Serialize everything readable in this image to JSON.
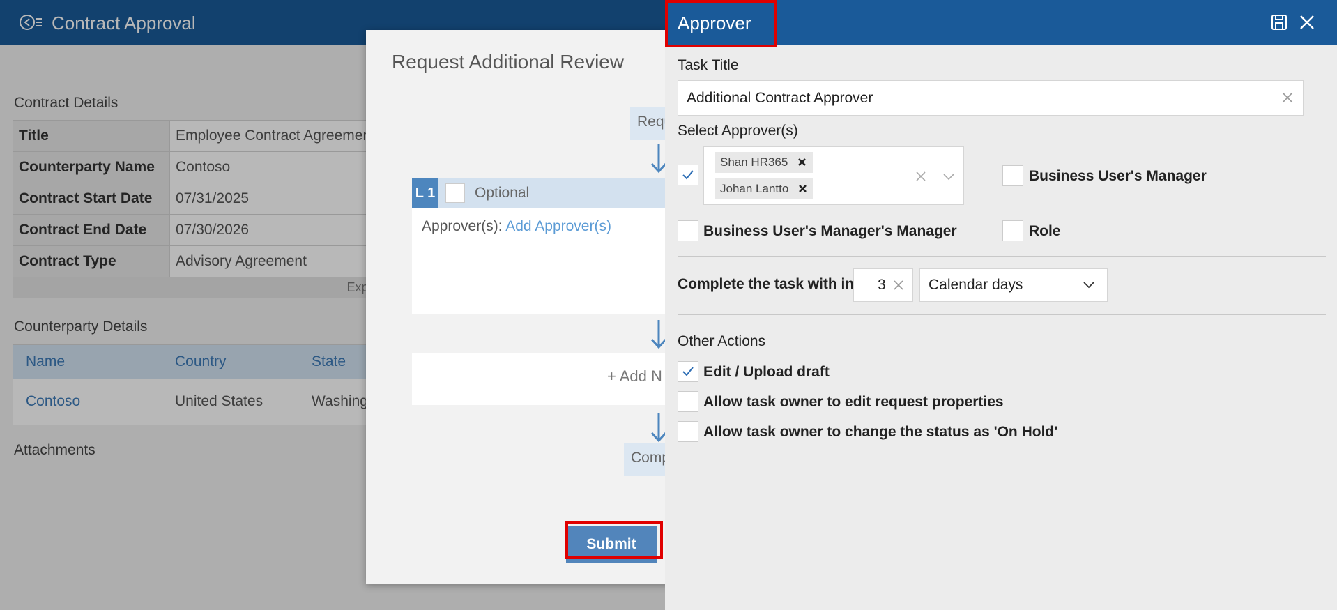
{
  "app": {
    "title": "Contract Approval"
  },
  "contract_details": {
    "section_title": "Contract Details",
    "rows": [
      {
        "label": "Title",
        "value": "Employee Contract Agreement"
      },
      {
        "label": "Counterparty Name",
        "value": "Contoso"
      },
      {
        "label": "Contract Start Date",
        "value": "07/31/2025"
      },
      {
        "label": "Contract End Date",
        "value": "07/30/2026"
      },
      {
        "label": "Contract Type",
        "value": "Advisory Agreement"
      }
    ],
    "expand_label": "Expa"
  },
  "counterparty_details": {
    "section_title": "Counterparty Details",
    "columns": [
      "Name",
      "Country",
      "State"
    ],
    "rows": [
      [
        "Contoso",
        "United States",
        "Washing"
      ]
    ]
  },
  "attachments": {
    "section_title": "Attachments"
  },
  "dialog": {
    "title": "Request Additional Review",
    "request_box": "Requ",
    "level": {
      "tag": "L 1",
      "optional_label": "Optional",
      "approvers_label": "Approver(s):",
      "add_approvers_link": "Add Approver(s)"
    },
    "add_next_label": "+ Add N",
    "complete_box": "Comp",
    "submit_label": "Submit"
  },
  "panel": {
    "title": "Approver",
    "task_title_label": "Task Title",
    "task_title_value": "Additional Contract Approver",
    "select_approvers_label": "Select Approver(s)",
    "approver_chips": [
      "Shan HR365",
      "Johan Lantto"
    ],
    "select_approvers_checked": true,
    "options": {
      "business_users_manager": {
        "label": "Business User's Manager",
        "checked": false
      },
      "business_users_managers_manager": {
        "label": "Business User's Manager's Manager",
        "checked": false
      },
      "role": {
        "label": "Role",
        "checked": false
      }
    },
    "complete_within_label": "Complete the task with in",
    "complete_within_value": "3",
    "complete_within_unit": "Calendar days",
    "other_actions_label": "Other Actions",
    "other_actions": [
      {
        "label": "Edit / Upload draft",
        "checked": true
      },
      {
        "label": "Allow task owner to edit request properties",
        "checked": false
      },
      {
        "label": "Allow task owner to change the status as 'On Hold'",
        "checked": false
      }
    ]
  },
  "colors": {
    "header_blue": "#1a5a99",
    "accent_blue": "#5285bb",
    "link_blue": "#5b9bd5",
    "highlight_red": "#e00000"
  }
}
